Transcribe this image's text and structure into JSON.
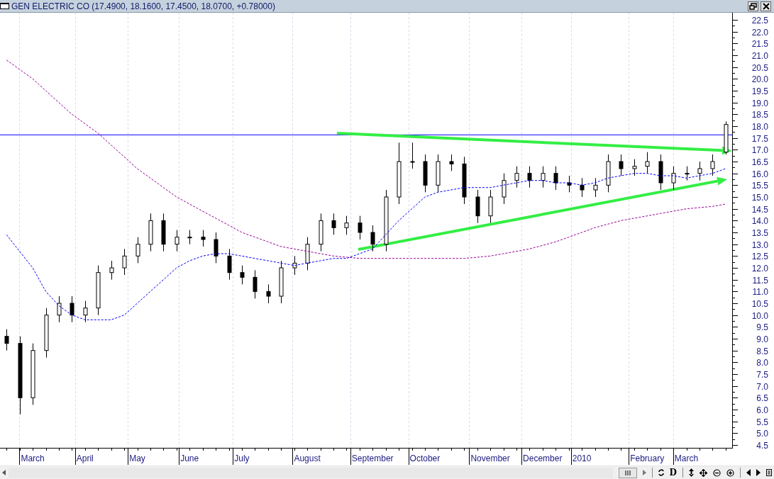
{
  "window": {
    "title": "GEN ELECTRIC CO (17.4900, 18.1600, 17.4500, 18.0700, +0.78000)"
  },
  "chart": {
    "chart_data": {
      "type": "candlestick",
      "categories": [
        null,
        null,
        "March",
        null,
        null,
        null,
        "April",
        null,
        null,
        null,
        "May",
        null,
        null,
        null,
        "June",
        null,
        null,
        null,
        "July",
        null,
        null,
        null,
        null,
        "August",
        null,
        null,
        null,
        null,
        "September",
        null,
        null,
        null,
        "October",
        null,
        null,
        null,
        null,
        "November",
        null,
        null,
        null,
        "December",
        null,
        null,
        "2010",
        null,
        null,
        null,
        null,
        "February",
        null,
        null,
        "March",
        null,
        null,
        null
      ],
      "grid": true,
      "ylim": [
        4.38,
        22.8
      ],
      "yticks": [
        {
          "value": 22.5,
          "label": "22.5"
        },
        {
          "value": 22,
          "label": "22.0"
        },
        {
          "value": 21.5,
          "label": "21.5"
        },
        {
          "value": 21,
          "label": "21.0"
        },
        {
          "value": 20.5,
          "label": "20.5"
        },
        {
          "value": 20,
          "label": "20.0"
        },
        {
          "value": 19.5,
          "label": "19.5"
        },
        {
          "value": 19,
          "label": "19.0"
        },
        {
          "value": 18.5,
          "label": "18.5"
        },
        {
          "value": 18,
          "label": "18.0"
        },
        {
          "value": 17.5,
          "label": "17.5"
        },
        {
          "value": 17,
          "label": "17.0"
        },
        {
          "value": 16.5,
          "label": "16.5"
        },
        {
          "value": 16,
          "label": "16.0"
        },
        {
          "value": 15.5,
          "label": "15.5"
        },
        {
          "value": 15,
          "label": "15.0"
        },
        {
          "value": 14.5,
          "label": "14.5"
        },
        {
          "value": 14,
          "label": "14.0"
        },
        {
          "value": 13.5,
          "label": "13.5"
        },
        {
          "value": 13,
          "label": "13.0"
        },
        {
          "value": 12.5,
          "label": "12.5"
        },
        {
          "value": 12,
          "label": "12.0"
        },
        {
          "value": 11.5,
          "label": "11.5"
        },
        {
          "value": 11,
          "label": "11.0"
        },
        {
          "value": 10.5,
          "label": "10.5"
        },
        {
          "value": 10,
          "label": "10.0"
        },
        {
          "value": 9.5,
          "label": "9.5"
        },
        {
          "value": 9,
          "label": "9.0"
        },
        {
          "value": 8.5,
          "label": "8.5"
        },
        {
          "value": 8,
          "label": "8.0"
        },
        {
          "value": 7.5,
          "label": "7.5"
        },
        {
          "value": 7,
          "label": "7.0"
        },
        {
          "value": 6.5,
          "label": "6.5"
        },
        {
          "value": 6,
          "label": "6.0"
        },
        {
          "value": 5.5,
          "label": "5.5"
        },
        {
          "value": 5,
          "label": "5.0"
        },
        {
          "value": 4.5,
          "label": "4.5"
        }
      ],
      "ohlc": [
        [
          9.1,
          9.4,
          8.5,
          8.8
        ],
        [
          8.8,
          9.1,
          5.8,
          6.5
        ],
        [
          6.5,
          8.8,
          6.2,
          8.5
        ],
        [
          8.5,
          10.3,
          8.2,
          10
        ],
        [
          10,
          10.8,
          9.7,
          10.5
        ],
        [
          10.5,
          10.8,
          9.7,
          10
        ],
        [
          10,
          10.6,
          9.7,
          10.3
        ],
        [
          10.3,
          12.1,
          10,
          11.8
        ],
        [
          11.8,
          12.3,
          11.5,
          12
        ],
        [
          12,
          12.8,
          11.7,
          12.5
        ],
        [
          12.5,
          13.3,
          12.2,
          13
        ],
        [
          13,
          14.3,
          12.7,
          14
        ],
        [
          14,
          14.3,
          12.7,
          13
        ],
        [
          13,
          13.6,
          12.7,
          13.3
        ],
        [
          13.3,
          13.6,
          13,
          13.3
        ],
        [
          13.3,
          13.6,
          12.9,
          13.2
        ],
        [
          13.2,
          13.5,
          12.2,
          12.5
        ],
        [
          12.5,
          12.8,
          11.5,
          11.8
        ],
        [
          11.8,
          12.1,
          11.3,
          11.6
        ],
        [
          11.6,
          11.9,
          10.7,
          11
        ],
        [
          11,
          11.3,
          10.5,
          10.8
        ],
        [
          10.8,
          12.3,
          10.5,
          12
        ],
        [
          12,
          12.5,
          11.7,
          12.2
        ],
        [
          12.2,
          13.3,
          11.9,
          13
        ],
        [
          13,
          14.3,
          12.7,
          14
        ],
        [
          14,
          14.3,
          13.4,
          13.7
        ],
        [
          13.7,
          14.2,
          13.4,
          13.9
        ],
        [
          13.9,
          14.2,
          13.2,
          13.5
        ],
        [
          13.5,
          13.8,
          12.7,
          13
        ],
        [
          13,
          15.3,
          12.7,
          15
        ],
        [
          15,
          17.3,
          14.7,
          16.5
        ],
        [
          16.5,
          17.3,
          16.2,
          16.5
        ],
        [
          16.5,
          16.8,
          15.2,
          15.5
        ],
        [
          15.5,
          16.8,
          15.2,
          16.5
        ],
        [
          16.5,
          16.8,
          16.1,
          16.4
        ],
        [
          16.4,
          16.7,
          14.7,
          15
        ],
        [
          15,
          15.3,
          13.9,
          14.2
        ],
        [
          14.2,
          15.3,
          13.9,
          15
        ],
        [
          15,
          16,
          14.7,
          15.7
        ],
        [
          15.7,
          16.3,
          15.4,
          16
        ],
        [
          16,
          16.3,
          15.4,
          15.7
        ],
        [
          15.7,
          16.3,
          15.4,
          16
        ],
        [
          16,
          16.3,
          15.3,
          15.6
        ],
        [
          15.6,
          15.9,
          15.2,
          15.5
        ],
        [
          15.5,
          15.8,
          15,
          15.3
        ],
        [
          15.3,
          15.8,
          15,
          15.5
        ],
        [
          15.5,
          16.8,
          15.2,
          16.5
        ],
        [
          16.5,
          16.8,
          15.9,
          16.2
        ],
        [
          16.2,
          16.6,
          15.9,
          16.3
        ],
        [
          16.3,
          16.9,
          16,
          16.5
        ],
        [
          16.5,
          16.8,
          15.3,
          15.6
        ],
        [
          15.6,
          16.3,
          15.3,
          16
        ],
        [
          16,
          16.3,
          15.7,
          16
        ],
        [
          16,
          16.5,
          15.7,
          16.2
        ],
        [
          16.2,
          16.8,
          15.9,
          16.5
        ],
        [
          16.9,
          18.2,
          16.8,
          18.07
        ]
      ],
      "series": [
        {
          "type": "line",
          "line_style": "dashed",
          "color": "#0000ff",
          "values": [
            13.4,
            12.7,
            12,
            11,
            10.4,
            10,
            9.8,
            9.8,
            9.8,
            10,
            10.5,
            11,
            11.5,
            12,
            12.3,
            12.5,
            12.6,
            12.6,
            12.5,
            12.4,
            12.3,
            12.2,
            12.1,
            12.2,
            12.3,
            12.4,
            12.4,
            12.6,
            12.8,
            13.4,
            14,
            14.5,
            15,
            15.2,
            15.3,
            15.4,
            15.4,
            15.4,
            15.5,
            15.6,
            15.7,
            15.7,
            15.6,
            15.6,
            15.5,
            15.6,
            15.8,
            15.9,
            16,
            16,
            15.9,
            15.9,
            15.8,
            15.9,
            16,
            16.2
          ]
        },
        {
          "type": "line",
          "line_style": "dashed",
          "color": "#990099",
          "values": [
            20.8,
            20.4,
            20,
            19.5,
            19,
            18.5,
            18.1,
            17.7,
            17.2,
            16.7,
            16.2,
            15.8,
            15.4,
            15,
            14.7,
            14.4,
            14.1,
            13.8,
            13.5,
            13.3,
            13.1,
            12.9,
            12.8,
            12.7,
            12.6,
            12.5,
            12.45,
            12.4,
            12.4,
            12.4,
            12.4,
            12.4,
            12.4,
            12.4,
            12.4,
            12.4,
            12.45,
            12.5,
            12.6,
            12.7,
            12.8,
            12.95,
            13.1,
            13.3,
            13.5,
            13.7,
            13.85,
            14,
            14.1,
            14.2,
            14.3,
            14.4,
            14.5,
            14.55,
            14.6,
            14.7
          ]
        }
      ],
      "ref_lines": [
        {
          "axis": "y",
          "value": 17.63
        }
      ]
    }
  },
  "toolbar": {
    "button_text": "D"
  }
}
